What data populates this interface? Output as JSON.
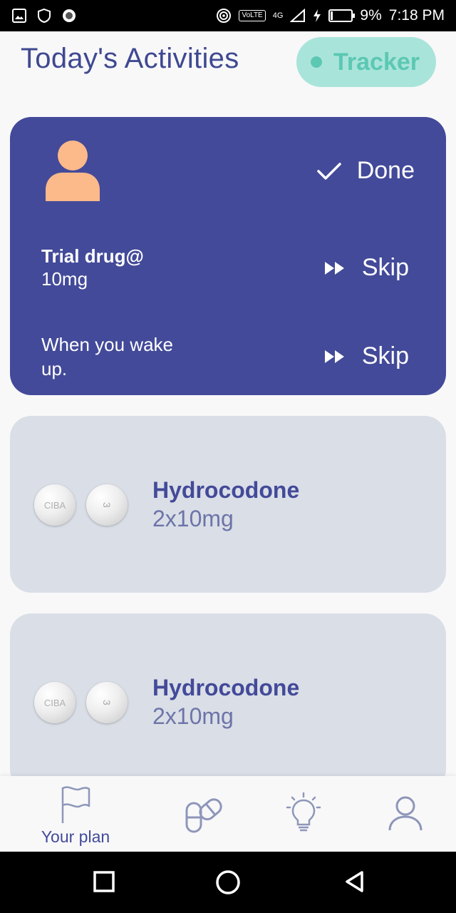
{
  "status_bar": {
    "battery": "9%",
    "battery_level": 0.09,
    "time": "7:18 PM",
    "volte": "VoLTE",
    "network": "4G"
  },
  "header": {
    "title": "Today's Activities",
    "tracker_label": "Tracker"
  },
  "active_card": {
    "done_label": "Done",
    "drug_name": "Trial drug@",
    "drug_dose": "10mg",
    "skip_label_1": "Skip",
    "wake_text": "When you wake up.",
    "skip_label_2": "Skip"
  },
  "pills": {
    "imprint_1": "CIBA",
    "imprint_2": "3"
  },
  "medications": [
    {
      "name": "Hydrocodone",
      "dose": "2x10mg"
    },
    {
      "name": "Hydrocodone",
      "dose": "2x10mg"
    }
  ],
  "bottom_nav": {
    "items": [
      {
        "label": "Your plan",
        "icon": "flag-icon",
        "active": true
      },
      {
        "label": "",
        "icon": "pills-icon"
      },
      {
        "label": "",
        "icon": "lightbulb-icon"
      },
      {
        "label": "",
        "icon": "user-icon"
      }
    ]
  },
  "colors": {
    "primary": "#434a99",
    "tracker_bg": "#a9e4da",
    "tracker_fg": "#5cc8b3",
    "card_bg": "#dadee6",
    "avatar": "#fcb98a"
  }
}
